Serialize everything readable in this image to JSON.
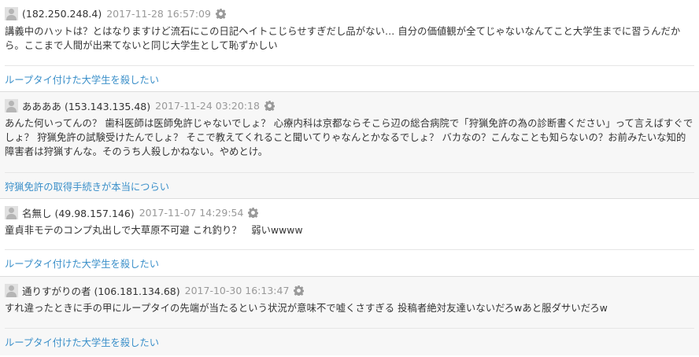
{
  "comments": [
    {
      "author": "(182.250.248.4)",
      "date": "2017-11-28 16:57:09",
      "body": "講義中のハットは？とはなりますけど流石にこの日記ヘイトこじらせすぎだし品がない… 自分の価値観が全てじゃないなんてこと大学生までに習うんだから。ここまで人間が出来てないと同じ大学生として恥ずかしい",
      "related": "ループタイ付けた大学生を殺したい"
    },
    {
      "author": "ああああ (153.143.135.48)",
      "date": "2017-11-24 03:20:18",
      "body": "あんた何いってんの？ 歯科医師は医師免許じゃないでしょ？ 心療内科は京都ならそこら辺の総合病院で「狩猟免許の為の診断書ください」って言えばすぐでしょ？ 狩猟免許の試験受けたんでしょ？ そこで教えてくれること聞いてりゃなんとかなるでしょ？ バカなの？こんなことも知らないの？お前みたいな知的障害者は狩猟すんな。そのうち人殺しかねない。やめとけ。",
      "related": "狩猟免許の取得手続きが本当につらい"
    },
    {
      "author": "名無し (49.98.157.146)",
      "date": "2017-11-07 14:29:54",
      "body": "童貞非モテのコンプ丸出しで大草原不可避 これ釣り？　弱いwwww",
      "related": "ループタイ付けた大学生を殺したい"
    },
    {
      "author": "通りすがりの者 (106.181.134.68)",
      "date": "2017-10-30 16:13:47",
      "body": "すれ違ったときに手の甲にループタイの先端が当たるという状況が意味不で嘘くさすぎる 投稿者絶対友達いないだろwあと服ダサいだろw",
      "related": "ループタイ付けた大学生を殺したい"
    }
  ],
  "icons": {
    "avatar": "default-user-avatar-icon",
    "settings": "gear-icon"
  },
  "colors": {
    "link": "#3a8fc9",
    "date": "#999999",
    "alt_background": "#f7f7f7"
  }
}
